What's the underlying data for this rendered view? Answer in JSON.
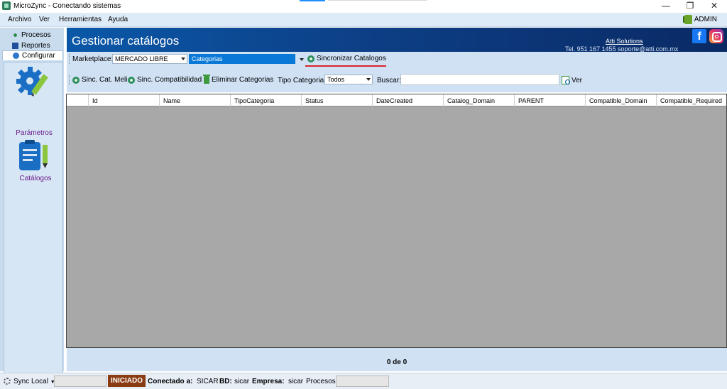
{
  "window": {
    "title": "MicroZync - Conectando sistemas",
    "controls": {
      "minimize": "—",
      "restore": "❐",
      "close": "✕"
    }
  },
  "menu": {
    "items": [
      {
        "label": "Archivo"
      },
      {
        "label": "Ver"
      },
      {
        "label": "Herramientas"
      },
      {
        "label": "Ayuda"
      }
    ],
    "user": "ADMIN"
  },
  "sidebar": {
    "tabs": [
      {
        "label": "Procesos",
        "icon": "processes-icon"
      },
      {
        "label": "Reportes",
        "icon": "reports-icon"
      },
      {
        "label": "Configurar",
        "icon": "configure-icon"
      }
    ],
    "active_tab": "Configurar",
    "items": [
      {
        "label": "Parámetros",
        "icon": "gear-pencil-icon"
      },
      {
        "label": "Catálogos",
        "icon": "clipboard-pencil-icon"
      }
    ]
  },
  "header": {
    "title": "Gestionar catálogos",
    "company": "Atti Solutions",
    "contact": "Tel. 951 167 1455  soporte@atti.com.mx",
    "social": [
      "facebook-icon",
      "instagram-icon"
    ]
  },
  "toolbar1": {
    "marketplace_label": "Marketplace:",
    "marketplace_value": "MERCADO LIBRE",
    "type_value": "Categorias",
    "sync_button": "Sincronizar Catalogos"
  },
  "toolbar2": {
    "sync_meli": "Sinc. Cat. Meli",
    "sync_compat": "Sinc. Compatibilidad",
    "delete_categories": "Eliminar Categorias",
    "category_type_label": "Tipo Categoria:",
    "category_type_value": "Todos",
    "search_label": "Buscar:",
    "search_value": "",
    "view_button": "Ver"
  },
  "grid": {
    "columns": [
      "",
      "Id",
      "Name",
      "TipoCategoria",
      "Status",
      "DateCreated",
      "Catalog_Domain",
      "PARENT",
      "Compatible_Domain",
      "Compatible_Required"
    ],
    "rows": []
  },
  "pager": {
    "text": "0 de 0"
  },
  "status": {
    "sync_label": "Sync Local",
    "state": "INICIADO",
    "connected_label": "Conectado a:",
    "connected_value": "SICAR",
    "db_label": "BD:",
    "db_value": "sicar",
    "company_label": "Empresa:",
    "company_value": "sicar",
    "process_label": "Procesos"
  },
  "colors": {
    "banner": "#0d3f86",
    "toolbar": "#cfe1f3",
    "grid_bg": "#a8a8a8",
    "status_badge": "#8a3b12",
    "highlight": "#d7252a"
  }
}
